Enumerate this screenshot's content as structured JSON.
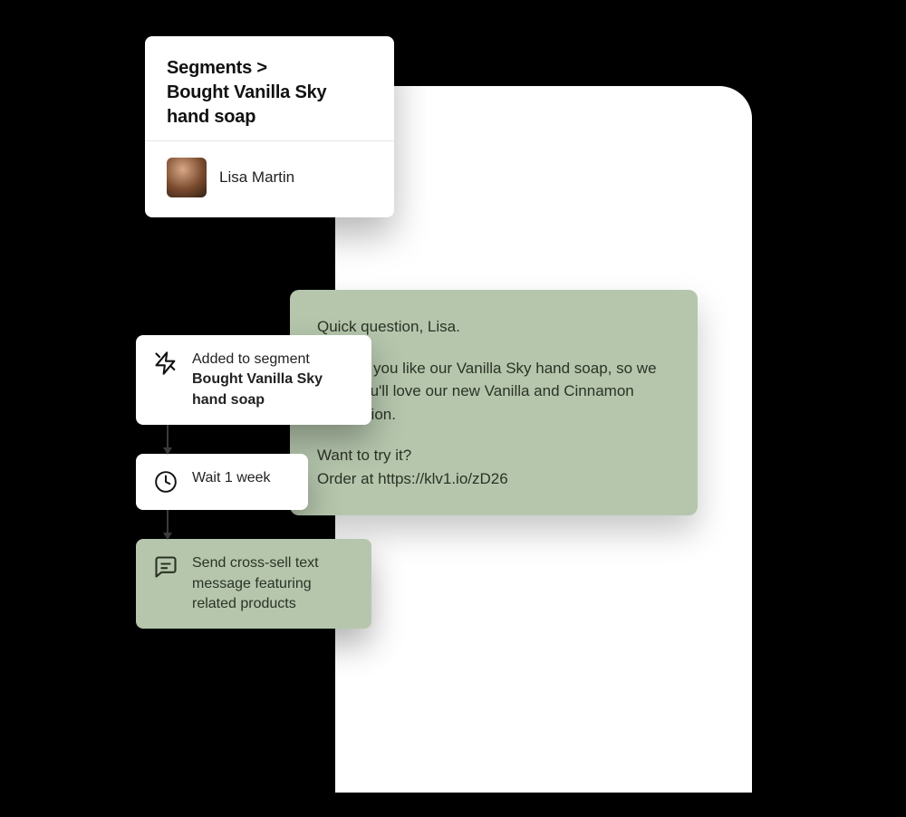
{
  "segment": {
    "breadcrumb_root": "Segments",
    "breadcrumb_sep": ">",
    "title_line1": "Bought Vanilla Sky",
    "title_line2": "hand soap",
    "contact_name": "Lisa Martin"
  },
  "flow": {
    "trigger": {
      "prefix": "Added to segment",
      "name_line1": "Bought Vanilla Sky",
      "name_line2": "hand soap"
    },
    "wait": {
      "label": "Wait 1 week"
    },
    "action": {
      "label": "Send cross-sell text message featuring related products"
    }
  },
  "message": {
    "p1": "Quick question, Lisa.",
    "p2": "We see you like our Vanilla Sky hand soap, so we think you'll love our new Vanilla and Cinnamon body lotion.",
    "p3a": "Want to try it?",
    "p3b": "Order at https://klv1.io/zD26"
  },
  "colors": {
    "accent_green": "#b5c6ad",
    "text_dark_green": "#2b3324"
  }
}
